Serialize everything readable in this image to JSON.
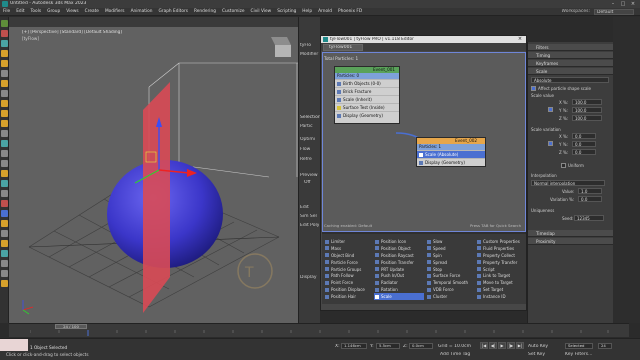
{
  "app": {
    "title": "Untitled - Autodesk 3ds Max 2023",
    "workspace_label": "Workspaces:",
    "workspace_value": "Default"
  },
  "menu": [
    "File",
    "Edit",
    "Tools",
    "Group",
    "Views",
    "Create",
    "Modifiers",
    "Animation",
    "Graph Editors",
    "Rendering",
    "Customize",
    "Civil View",
    "Scripting",
    "Help",
    "Arnold",
    "Phoenix FD"
  ],
  "viewport": {
    "label": "[+] [Perspective] [Standard] [Default Shading]",
    "sublabel": "[tyFlow]"
  },
  "command_panel": {
    "labels": [
      "tyFlo",
      "Modifier L",
      "Selection",
      "Partic",
      "Optimi",
      "Flow",
      "Refre",
      "Preview",
      "Off",
      "Edit",
      "Sim Sel",
      "Edit Poly",
      "Display"
    ]
  },
  "tyflow": {
    "window_title": "tyFlow001 | tyFlow PRO | v1.118 Editor",
    "tab": "tyFlow001",
    "graph_label": "Total Particles: 1",
    "status_left": "Caching enabled: Default",
    "status_right": "Press TAB for Quick Search",
    "events": [
      {
        "name": "Event_001",
        "sub": "Particles: 0",
        "operators": [
          "Birth Objects (0-0)",
          "Brick Fracture",
          "Scale (Inherit)",
          "Surface Test (Inside)",
          "Display (Geometry)"
        ]
      },
      {
        "name": "Event_002",
        "sub": "Particles: 1",
        "operators": [
          "Scale (Absolute)",
          "Display (Geometry)"
        ]
      }
    ],
    "tools": [
      [
        "Limiter",
        "Mass",
        "Object Bind",
        "Particle Force",
        "Particle Groups",
        "Path Follow",
        "Point Force",
        "Position Displace",
        "Position Hair"
      ],
      [
        "Position Icon",
        "Position Object",
        "Position Raycast",
        "Position Transfer",
        "PRT Update",
        "Push In/Out",
        "Radiator",
        "Rotation",
        "Scale"
      ],
      [
        "Slow",
        "Speed",
        "Spin",
        "Spread",
        "Stop",
        "Surface Force",
        "Temporal Smooth",
        "VDB Force",
        "Cluster"
      ],
      [
        "Custom Properties",
        "Fluid Properties",
        "Property Collect",
        "Property Transfer",
        "Script",
        "Link to Target",
        "Move to Target",
        "Set Target",
        "Instance ID"
      ]
    ]
  },
  "properties": {
    "sections": [
      "Filters",
      "Timing",
      "Keyframes",
      "Scale"
    ],
    "mode": "Absolute",
    "affect_shape_scale": "Affect particle shape scale",
    "scale_value_label": "Scale value",
    "x_label": "X %:",
    "x_value": "100.0",
    "y_label": "Y %:",
    "y_value": "100.0",
    "z_label": "Z %:",
    "z_value": "100.0",
    "scale_variation_label": "Scale variation",
    "vx_value": "0.0",
    "vy_value": "0.0",
    "vz_value": "0.0",
    "uniform_label": "Uniform",
    "interpolation_label": "Interpolation",
    "interpolation_mode": "Normal interpolation",
    "value_label": "Value:",
    "value_value": "1.0",
    "variation_label": "Variation %:",
    "variation_value": "0.0",
    "uniqueness_label": "Uniqueness",
    "seed_label": "Seed:",
    "seed_value": "12345",
    "bottom_sections": [
      "Timeslap",
      "Proximity"
    ]
  },
  "timeline": {
    "frame": "24 / 100",
    "ticks": [
      "0",
      "5",
      "10",
      "15",
      "20",
      "25",
      "30",
      "35",
      "40",
      "45",
      "50",
      "55",
      "60",
      "65",
      "70",
      "75",
      "80",
      "85",
      "90",
      "95",
      "100"
    ]
  },
  "status": {
    "selected": "1 Object Selected",
    "hint": "Click or click-and-drag to select objects",
    "x_label": "X:",
    "x_value": "1.146cm",
    "y_label": "Y:",
    "y_value": "5.5cm",
    "z_label": "Z:",
    "z_value": "0.0cm",
    "grid": "Grid = 10.0cm",
    "add_time_tag": "Add Time Tag",
    "auto_key": "Auto Key",
    "selected_btn": "Selected",
    "set_key": "Set Key",
    "key_filters": "Key Filters...",
    "frame_field": "24"
  },
  "colors": {
    "sphere": "#3b36c9",
    "plane": "#d94a55",
    "selection": "#4a6fd1",
    "event1_head": "#5aa25a",
    "event2_head": "#e6a64a"
  }
}
